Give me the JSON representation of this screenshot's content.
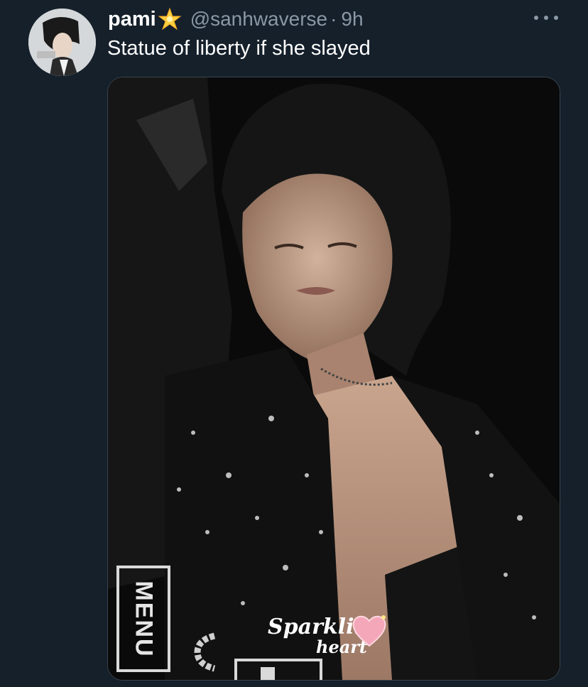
{
  "tweet": {
    "display_name": "pami",
    "name_emoji": "star-icon",
    "handle": "@sanhwaverse",
    "separator": "·",
    "time": "9h",
    "text": "Statue of liberty if she slayed"
  },
  "media": {
    "overlay_label": "MENU",
    "sticker_line1": "Sparkling",
    "sticker_line2": "heart"
  },
  "colors": {
    "background": "#15202b",
    "secondary_text": "#8b98a5",
    "primary_text": "#ffffff"
  }
}
